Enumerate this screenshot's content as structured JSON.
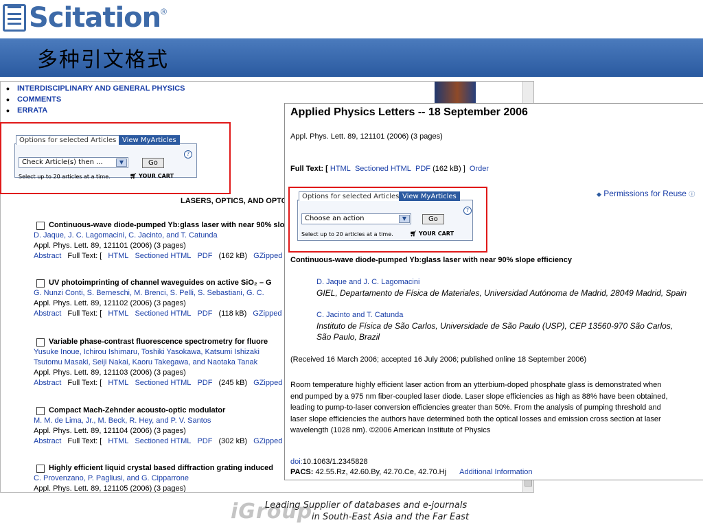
{
  "slide": {
    "logo_text": "Scitation",
    "logo_reg": "®",
    "title": "多种引文格式",
    "footer_brand": "iGroup",
    "footer_line1": "Leading Supplier of databases and e-journals",
    "footer_line2": "in South-East Asia and the Far East"
  },
  "toc": {
    "links": [
      "INTERDISCIPLINARY AND GENERAL PHYSICS",
      "COMMENTS",
      "ERRATA"
    ],
    "options": {
      "tab_label": "Options for selected Articles",
      "tab_myarticles": "View MyArticles",
      "select_value": "Check Article(s) then ...",
      "go_label": "Go",
      "help_label": "?",
      "note": "Select up to 20 articles at a time.",
      "cart_label": "YOUR CART"
    },
    "section_heading": "LASERS, OPTICS, AND OPTO",
    "articles": [
      {
        "title": "Continuous-wave diode-pumped Yb:glass laser with near 90% slope efficiency",
        "authors": "D. Jaque, J. C. Lagomacini, C. Jacinto, and T. Catunda",
        "citation": "Appl. Phys. Lett. 89, 121101 (2006) (3 pages)",
        "abstract": "Abstract",
        "fulltext": "Full Text: [",
        "html": "HTML",
        "sectioned": "Sectioned HTML",
        "pdf": "PDF",
        "size": "(162 kB)",
        "gzip": "GZipped"
      },
      {
        "title": "UV photoimprinting of channel waveguides on active SiO₂ – G",
        "authors": "G. Nunzi Conti, S. Berneschi, M. Brenci, S. Pelli, S. Sebastiani, G. C.",
        "citation": "Appl. Phys. Lett. 89, 121102 (2006) (3 pages)",
        "abstract": "Abstract",
        "fulltext": "Full Text: [",
        "html": "HTML",
        "sectioned": "Sectioned HTML",
        "pdf": "PDF",
        "size": "(118 kB)",
        "gzip": "GZipped"
      },
      {
        "title": "Variable phase-contrast fluorescence spectrometry for fluore",
        "authors": "Yusuke Inoue, Ichirou Ishimaru, Toshiki Yasokawa, Katsumi Ishizaki",
        "authors2": "Tsutomu Masaki, Seiji Nakai, Kaoru Takegawa, and Naotaka Tanak",
        "citation": "Appl. Phys. Lett. 89, 121103 (2006) (3 pages)",
        "abstract": "Abstract",
        "fulltext": "Full Text: [",
        "html": "HTML",
        "sectioned": "Sectioned HTML",
        "pdf": "PDF",
        "size": "(245 kB)",
        "gzip": "GZipped"
      },
      {
        "title": "Compact Mach-Zehnder acousto-optic modulator",
        "authors": "M. M. de Lima, Jr., M. Beck, R. Hey, and P. V. Santos",
        "citation": "Appl. Phys. Lett. 89, 121104 (2006) (3 pages)",
        "abstract": "Abstract",
        "fulltext": "Full Text: [",
        "html": "HTML",
        "sectioned": "Sectioned HTML",
        "pdf": "PDF",
        "size": "(302 kB)",
        "gzip": "GZipped"
      },
      {
        "title": "Highly efficient liquid crystal based diffraction grating induced",
        "authors": "C. Provenzano, P. Pagliusi, and G. Cipparrone",
        "citation": "Appl. Phys. Lett. 89, 121105 (2006) (3 pages)"
      }
    ]
  },
  "article": {
    "title": "Applied Physics Letters -- 18 September 2006",
    "citation": "Appl. Phys. Lett. 89, 121101 (2006) (3 pages)",
    "fulltext_label": "Full Text:  [",
    "html": "HTML",
    "sectioned": "Sectioned HTML",
    "pdf": "PDF",
    "size": "(162 kB)  ]",
    "order": "Order",
    "permissions": "Permissions for Reuse",
    "options": {
      "tab_label": "Options for selected Articles",
      "tab_myarticles": "View MyArticles",
      "select_value": "Choose an action",
      "go_label": "Go",
      "help_label": "?",
      "note": "Select up to 20 articles at a time.",
      "cart_label": "YOUR CART"
    },
    "paper_title": "Continuous-wave diode-pumped Yb:glass laser with near 90% slope efficiency",
    "author_group1": "D. Jaque and J. C. Lagomacini",
    "affil1": "GIEL, Departamento de Física de Materiales, Universidad Autónoma de Madrid, 28049 Madrid, Spain",
    "author_group2": "C. Jacinto and T. Catunda",
    "affil2a": "Instituto de Física de São Carlos, Universidade de São Paulo (USP), CEP 13560-970 São Carlos,",
    "affil2b": "São Paulo, Brazil",
    "received": "(Received 16 March 2006; accepted 16 July 2006; published online 18 September 2006)",
    "abstract_lines": [
      "Room temperature highly efficient laser action from an ytterbium-doped phosphate glass is demonstrated when",
      "end pumped by a 975  nm fiber-coupled laser diode. Laser slope efficiencies as high as 88% have been obtained,",
      "leading to pump-to-laser conversion efficiencies greater than 50%. From the analysis of pumping threshold and",
      "laser slope efficiencies the authors have determined both the optical losses and emission cross section at laser",
      "wavelength (1028  nm). ©2006 American Institute of Physics"
    ],
    "doi_label": "doi:",
    "doi_value": "10.1063/1.2345828",
    "pacs_label": "PACS:",
    "pacs_value": "42.55.Rz, 42.60.By, 42.70.Ce, 42.70.Hj",
    "additional": "Additional Information"
  }
}
